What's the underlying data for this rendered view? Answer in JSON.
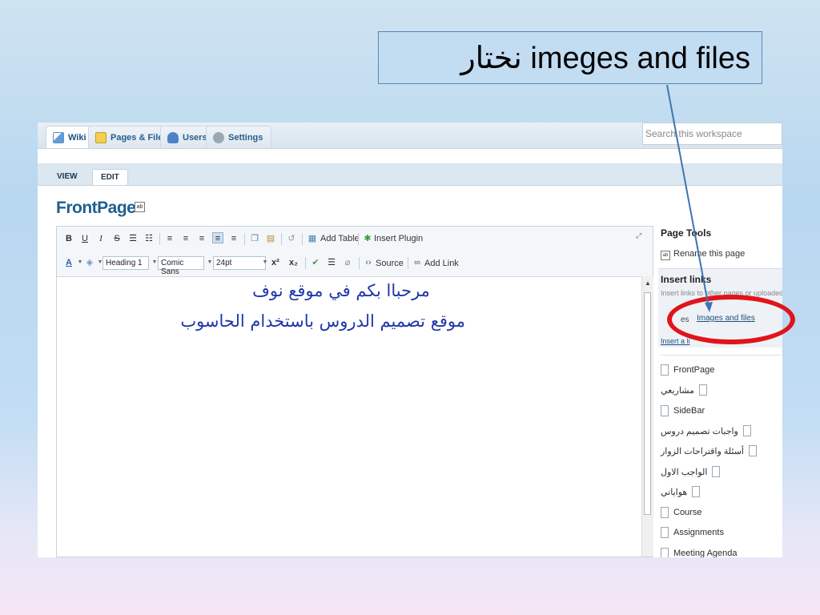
{
  "callout": {
    "text": "نختار imeges and files"
  },
  "tabs": [
    {
      "label": "Wiki",
      "icon": "wiki-icon"
    },
    {
      "label": "Pages & Files",
      "icon": "pages-files-icon"
    },
    {
      "label": "Users",
      "icon": "users-icon"
    },
    {
      "label": "Settings",
      "icon": "settings-icon"
    }
  ],
  "search": {
    "placeholder": "Search this workspace"
  },
  "subtabs": {
    "view": "VIEW",
    "edit": "EDIT"
  },
  "page": {
    "title": "FrontPage"
  },
  "toolbar": {
    "bold": "B",
    "underline": "U",
    "italic": "I",
    "strike": "S",
    "add_table": "Add Table",
    "insert_plugin": "Insert Plugin",
    "format": "Heading 1",
    "font": "Comic Sans",
    "size": "24pt",
    "source": "Source",
    "add_link": "Add Link",
    "superscript": "x²",
    "subscript": "x₂"
  },
  "content": {
    "line1": "مرحباا بكم في موقع نوف",
    "line2": "موقع تصميم الدروس باستخدام الحاسوب"
  },
  "sidebar": {
    "page_tools": "Page Tools",
    "rename": "Rename this page",
    "insert_links": "Insert links",
    "insert_desc": "Insert links to other pages or uploaded",
    "pages_tab": "es",
    "images_files": "Images and files",
    "insert_a": "Insert a li",
    "pages": [
      {
        "label": "FrontPage",
        "rtl": false
      },
      {
        "label": "مشاريعي",
        "rtl": true
      },
      {
        "label": "SideBar",
        "rtl": false
      },
      {
        "label": "واجبات تصميم دروس",
        "rtl": true
      },
      {
        "label": "أسئلة واقتراحات الزوار",
        "rtl": true
      },
      {
        "label": "الواجب الاول",
        "rtl": true
      },
      {
        "label": "هواياتي",
        "rtl": true
      },
      {
        "label": "Course",
        "rtl": false
      },
      {
        "label": "Assignments",
        "rtl": false
      },
      {
        "label": "Meeting Agenda",
        "rtl": false
      }
    ]
  },
  "colors": {
    "accent": "#1f5f8e",
    "highlight": "#e0141a",
    "arrow": "#3f73b3",
    "arabic_text": "#2037a8"
  }
}
